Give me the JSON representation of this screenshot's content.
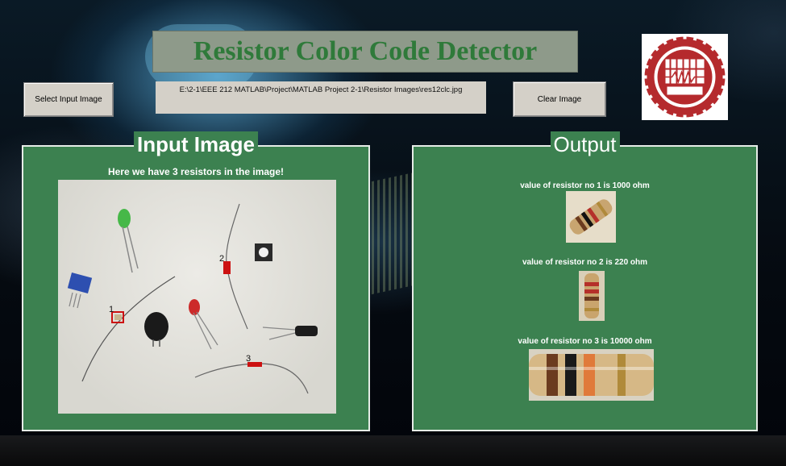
{
  "app": {
    "title": "Resistor Color Code Detector"
  },
  "buttons": {
    "select_input_label": "Select Input Image",
    "clear_label": "Clear Image"
  },
  "path_field": {
    "value": "E:\\2-1\\EEE 212 MATLAB\\Project\\MATLAB Project 2-1\\Resistor Images\\res12clc.jpg"
  },
  "input_panel": {
    "title": "Input Image",
    "subtitle": "Here we have 3 resistors in the image!",
    "markers": [
      "1",
      "2",
      "3"
    ]
  },
  "output_panel": {
    "title": "Output",
    "results": [
      {
        "label": "value of resistor no 1 is 1000 ohm"
      },
      {
        "label": "value of resistor no 2 is 220 ohm"
      },
      {
        "label": "value of resistor no 3 is 10000 ohm"
      }
    ]
  },
  "colors": {
    "panel_green": "#3c8150",
    "title_green": "#2f7a3a",
    "title_box": "#8e9a8a",
    "logo_red": "#b52a2d",
    "marker_red": "#cc1111"
  },
  "icons": {
    "logo": "university-seal-icon"
  }
}
